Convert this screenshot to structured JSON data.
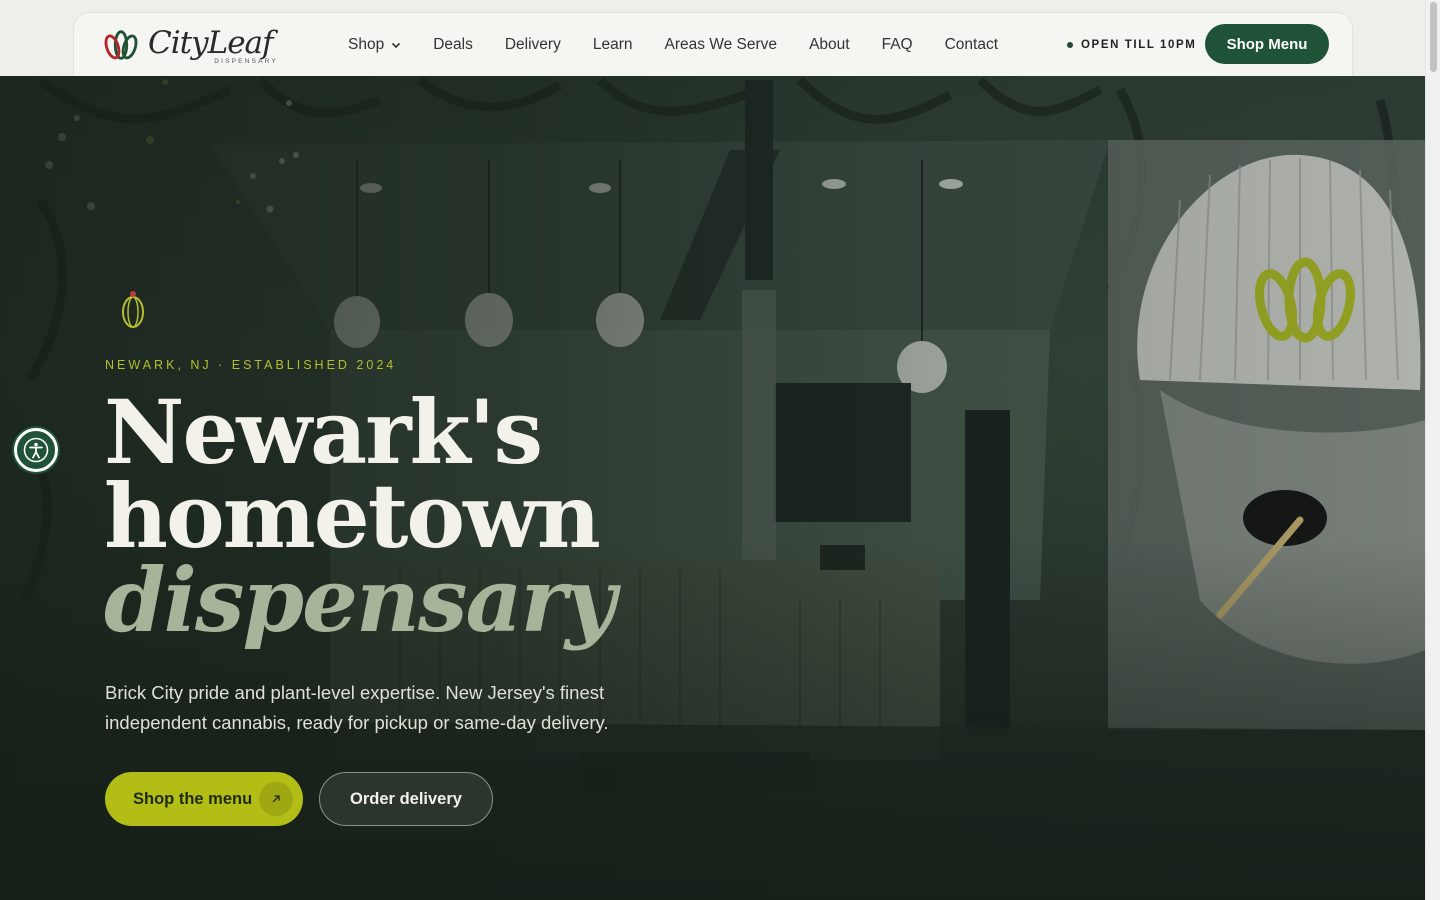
{
  "brand": {
    "name": "CityLeaf",
    "subtitle": "DISPENSARY"
  },
  "nav": {
    "items": [
      {
        "label": "Shop",
        "has_dropdown": true
      },
      {
        "label": "Deals"
      },
      {
        "label": "Delivery"
      },
      {
        "label": "Learn"
      },
      {
        "label": "Areas We Serve"
      },
      {
        "label": "About"
      },
      {
        "label": "FAQ"
      },
      {
        "label": "Contact"
      }
    ],
    "status": "OPEN TILL 10PM",
    "cta": "Shop Menu"
  },
  "hero": {
    "eyebrow": "NEWARK, NJ · ESTABLISHED 2024",
    "headline_line1": "Newark's",
    "headline_line2": "hometown",
    "headline_line3": "dispensary",
    "lede": "Brick City pride and plant-level expertise. New Jersey's finest independent cannabis, ready for pickup or same-day delivery.",
    "primary_cta": "Shop the menu",
    "secondary_cta": "Order delivery"
  },
  "colors": {
    "brand_green": "#1f5236",
    "accent_lime": "#b2bd16",
    "eyebrow_gold": "#b5bf2e",
    "headline_accent": "#a6b49a"
  },
  "icons": {
    "logo": "lotus-logo-icon",
    "dropdown": "chevron-down-icon",
    "status": "status-dot-icon",
    "arrow": "arrow-up-right-icon",
    "accessibility": "accessibility-icon",
    "eyebrow_mark": "leaf-outline-icon"
  }
}
